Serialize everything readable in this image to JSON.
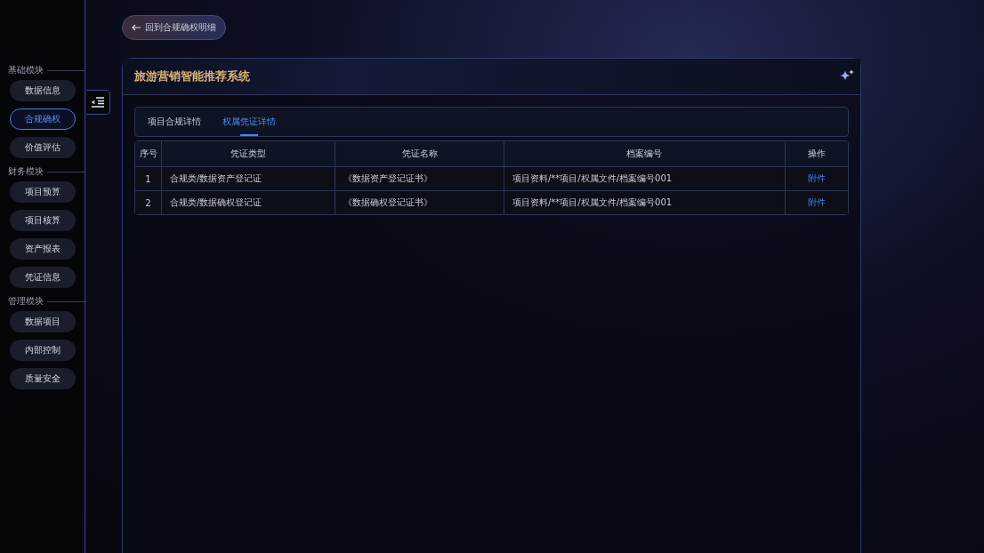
{
  "sidebar": {
    "groups": [
      {
        "title": "基础模块",
        "items": [
          {
            "label": "数据信息",
            "selected": false
          },
          {
            "label": "合规确权",
            "selected": true
          },
          {
            "label": "价值评估",
            "selected": false
          }
        ]
      },
      {
        "title": "财务模块",
        "items": [
          {
            "label": "项目预算",
            "selected": false
          },
          {
            "label": "项目核算",
            "selected": false
          },
          {
            "label": "资产报表",
            "selected": false
          },
          {
            "label": "凭证信息",
            "selected": false
          }
        ]
      },
      {
        "title": "管理模块",
        "items": [
          {
            "label": "数据项目",
            "selected": false
          },
          {
            "label": "内部控制",
            "selected": false
          },
          {
            "label": "质量安全",
            "selected": false
          }
        ]
      }
    ]
  },
  "back_button": {
    "label": "回到合规确权明细"
  },
  "panel": {
    "title": "旅游营销智能推荐系统"
  },
  "tabs": [
    {
      "label": "项目合规详情",
      "selected": false
    },
    {
      "label": "权属凭证详情",
      "selected": true
    }
  ],
  "table": {
    "columns": [
      "序号",
      "凭证类型",
      "凭证名称",
      "档案编号",
      "操作"
    ],
    "rows": [
      {
        "index": "1",
        "type": "合规类/数据资产登记证",
        "name": "《数据资产登记证书》",
        "archive": "项目资料/**项目/权属文件/档案编号001",
        "action": "附件"
      },
      {
        "index": "2",
        "type": "合规类/数据确权登记证",
        "name": "《数据确权登记证书》",
        "archive": "项目资料/**项目/权属文件/档案编号001",
        "action": "附件"
      }
    ]
  }
}
